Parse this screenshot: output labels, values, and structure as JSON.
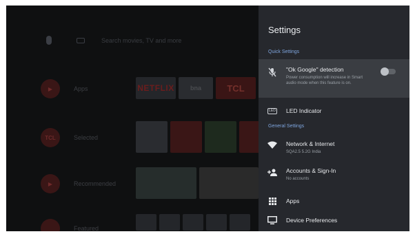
{
  "home": {
    "search_text": "Search movies, TV and more",
    "rows": [
      {
        "label": "Apps"
      },
      {
        "label": "Selected"
      },
      {
        "label": "Recommended"
      },
      {
        "label": "Featured"
      }
    ],
    "tiles": {
      "netflix": "NETFLIX",
      "tcl": "TCL",
      "tile_label": "bna"
    }
  },
  "settings": {
    "title": "Settings",
    "quick_section": "Quick Settings",
    "ok_google": {
      "title": "\"Ok Google\" detection",
      "subtitle": "Power consumption will increase in Smart audio mode when this feature is on.",
      "toggle_on": false
    },
    "led": {
      "title": "LED Indicator",
      "icon_text": "LED"
    },
    "general_section": "General Settings",
    "network": {
      "title": "Network & Internet",
      "subtitle": "SQA2.5 5.2G India"
    },
    "accounts": {
      "title": "Accounts & Sign-In",
      "subtitle": "No accounts"
    },
    "apps": {
      "title": "Apps"
    },
    "device": {
      "title": "Device Preferences"
    }
  },
  "colors": {
    "panel_bg": "#26282d",
    "highlight_bg": "#3a3d42",
    "section_blue": "#7fa6df",
    "home_bg": "#0f1011"
  }
}
